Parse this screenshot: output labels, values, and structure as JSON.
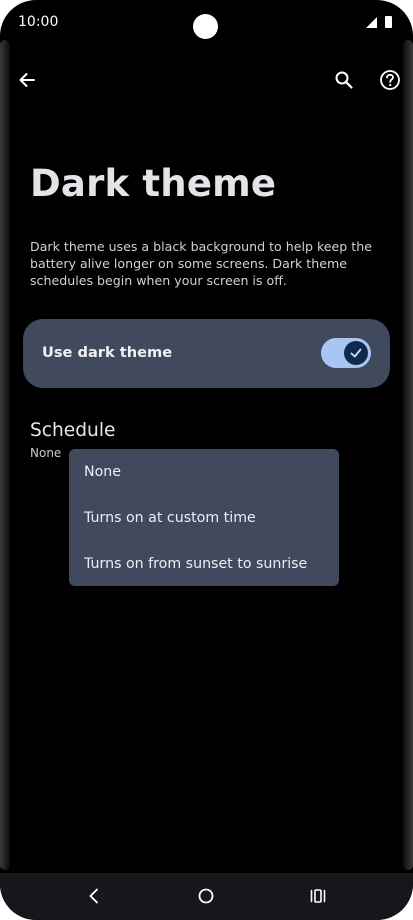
{
  "status_bar": {
    "time": "10:00",
    "icons": [
      "wifi-icon",
      "signal-icon",
      "battery-icon"
    ]
  },
  "toolbar": {
    "icons": [
      "arrow-left-icon",
      "search-icon",
      "help-circle-icon"
    ]
  },
  "page": {
    "title": "Dark theme",
    "description": "Dark theme uses a black background to help keep the battery alive longer on some screens. Dark theme schedules begin when your screen is off."
  },
  "dark_theme_toggle": {
    "label": "Use dark theme",
    "checked": true,
    "icon": "check-icon"
  },
  "schedule": {
    "heading": "Schedule",
    "value": "None",
    "options": [
      {
        "label": "None"
      },
      {
        "label": "Turns on at custom time"
      },
      {
        "label": "Turns on from sunset to sunrise"
      }
    ]
  },
  "nav_bar": {
    "icons": [
      "nav-back-icon",
      "nav-home-icon",
      "nav-recents-icon"
    ]
  },
  "colors": {
    "background": "#000000",
    "card": "#404a5c",
    "switch_track": "#a9c6f2",
    "switch_thumb": "#0f2a4d",
    "text_primary": "#e4e4e8",
    "nav_bar": "#15171c"
  }
}
